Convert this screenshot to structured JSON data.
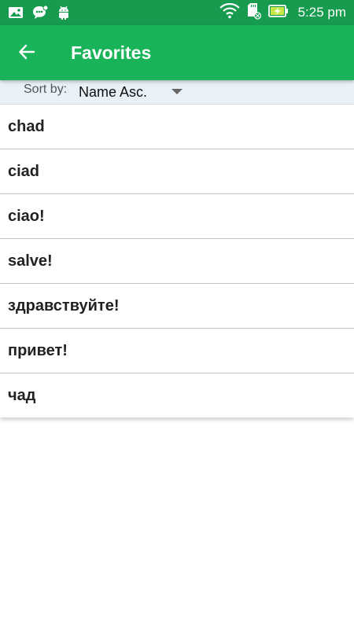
{
  "status_bar": {
    "time": "5:25 pm",
    "left_icons": [
      "gallery-icon",
      "chat-notification-icon",
      "android-icon"
    ],
    "right_icons": [
      "wifi-icon",
      "sd-card-icon",
      "battery-charging-icon"
    ],
    "background": "#169b4f"
  },
  "app_bar": {
    "title": "Favorites",
    "back_icon": "arrow-back-icon",
    "background": "#19b35a"
  },
  "sort": {
    "label": "Sort by:",
    "selected": "Name Asc."
  },
  "favorites": [
    {
      "text": "chad"
    },
    {
      "text": "ciad"
    },
    {
      "text": "ciao!"
    },
    {
      "text": "salve!"
    },
    {
      "text": "здравствуйте!"
    },
    {
      "text": "привет!"
    },
    {
      "text": "чад"
    }
  ]
}
